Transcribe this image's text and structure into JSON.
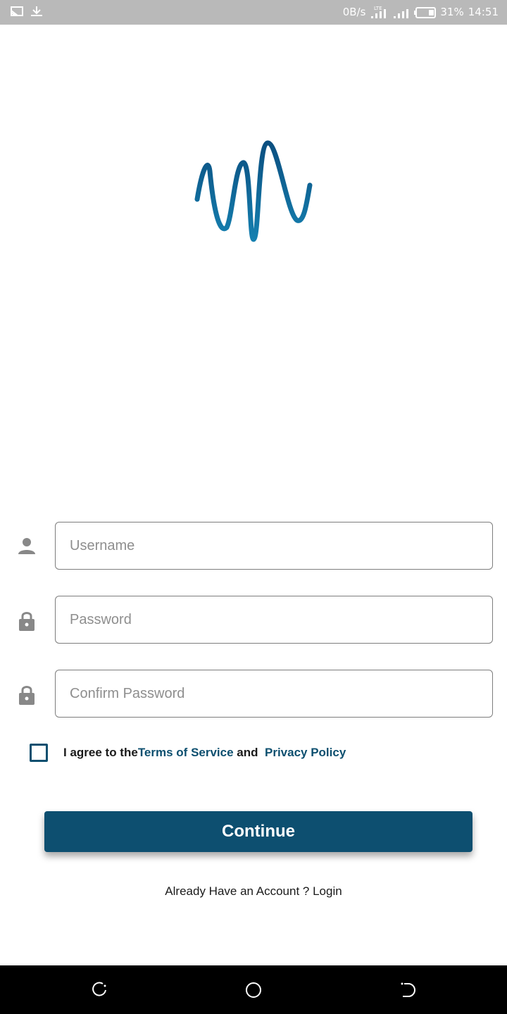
{
  "status_bar": {
    "net_speed": "0B/s",
    "network_type": "LTE",
    "battery": "31%",
    "time": "14:51",
    "left_icons": [
      "cast-icon",
      "download-icon"
    ]
  },
  "form": {
    "username_placeholder": "Username",
    "password_placeholder": "Password",
    "confirm_password_placeholder": "Confirm Password",
    "agree_prefix": "I agree to the",
    "terms_label": "Terms of Service",
    "and_label": " and  ",
    "privacy_label": "Privacy Policy",
    "agree_checked": false
  },
  "actions": {
    "continue_label": "Continue",
    "login_prompt": "Already Have an Account ? Login"
  },
  "colors": {
    "primary": "#0d4f70",
    "status_bar": "#b9b9b9",
    "nav_bar": "#000000"
  }
}
